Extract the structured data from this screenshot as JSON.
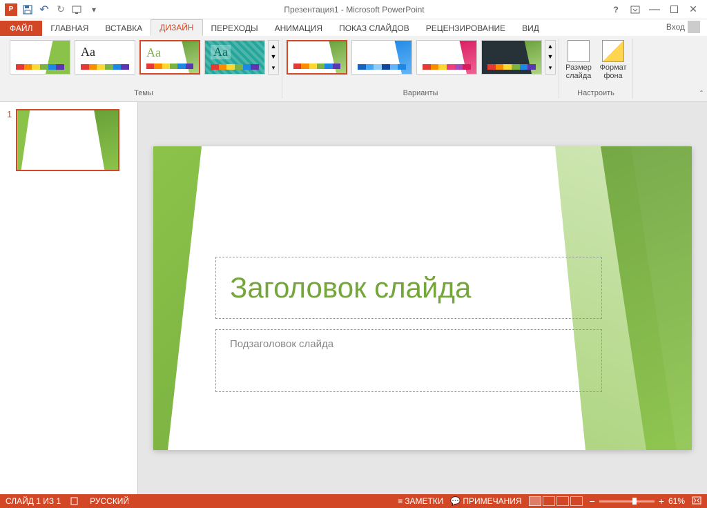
{
  "title": "Презентация1 - Microsoft PowerPoint",
  "login": "Вход",
  "tabs": {
    "file": "ФАЙЛ",
    "home": "ГЛАВНАЯ",
    "insert": "ВСТАВКА",
    "design": "ДИЗАЙН",
    "transitions": "ПЕРЕХОДЫ",
    "animation": "АНИМАЦИЯ",
    "slideshow": "ПОКАЗ СЛАЙДОВ",
    "review": "РЕЦЕНЗИРОВАНИЕ",
    "view": "ВИД"
  },
  "ribbon": {
    "themes_label": "Темы",
    "variants_label": "Варианты",
    "configure_label": "Настроить",
    "size_label": "Размер слайда",
    "format_label": "Формат фона"
  },
  "slide": {
    "num": "1",
    "title": "Заголовок слайда",
    "subtitle": "Подзаголовок слайда"
  },
  "status": {
    "counter": "СЛАЙД 1 ИЗ 1",
    "lang": "РУССКИЙ",
    "notes": "ЗАМЕТКИ",
    "comments": "ПРИМЕЧАНИЯ",
    "zoom": "61%"
  },
  "colors": {
    "accent": "#d24726",
    "theme_green": "#8bc34a"
  }
}
